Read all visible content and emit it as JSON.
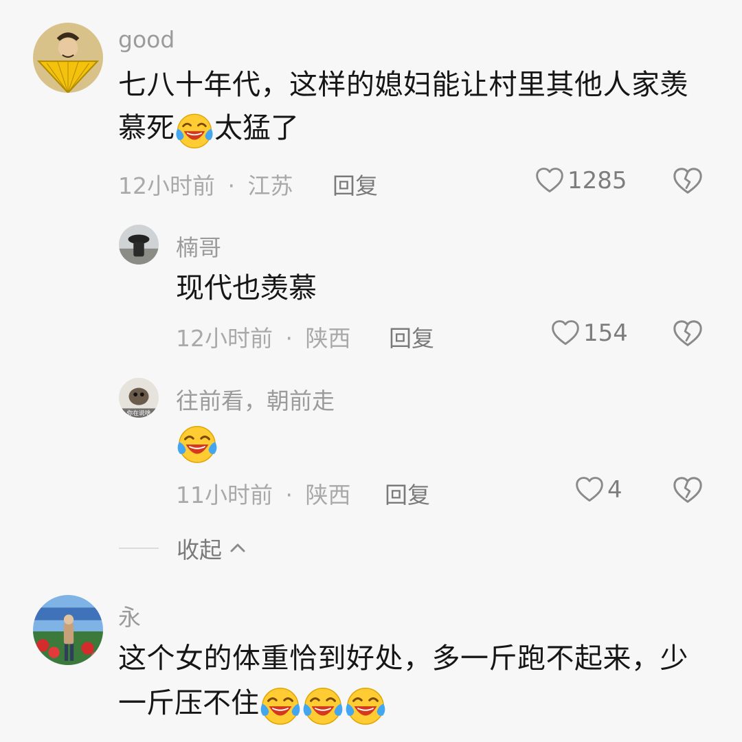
{
  "comments": [
    {
      "username": "good",
      "text_line1": "七八十年代，这样的媳妇能让村里其他人家羡",
      "text_line2_before": "慕死",
      "text_line2_after": "太猛了",
      "time": "12小时前",
      "location": "江苏",
      "reply_label": "回复",
      "likes": "1285"
    },
    {
      "username": "楠哥",
      "text": "现代也羡慕",
      "time": "12小时前",
      "location": "陕西",
      "reply_label": "回复",
      "likes": "154"
    },
    {
      "username": "往前看，朝前走",
      "avatar_caption": "你在说啥",
      "time": "11小时前",
      "location": "陕西",
      "reply_label": "回复",
      "likes": "4"
    },
    {
      "username": "永",
      "text_line1": "这个女的体重恰到好处，多一斤跑不起来，少",
      "text_line2": "一斤压不住"
    }
  ],
  "meta_separator": "·",
  "collapse_label": "收起",
  "icons": {
    "like": "heart-outline-icon",
    "dislike": "broken-heart-icon",
    "emoji": "laughing-crying-emoji",
    "collapse": "chevron-up-icon"
  },
  "colors": {
    "background": "#f7f7f7",
    "text": "#161616",
    "muted": "#a9a9a9",
    "username": "#9b9b9b"
  }
}
